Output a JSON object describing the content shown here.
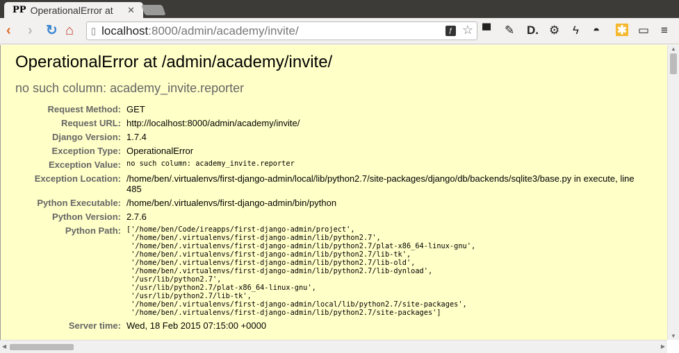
{
  "browser": {
    "tab_title": "OperationalError at",
    "tab_favicon": "PP",
    "url_host": "localhost",
    "url_rest": ":8000/admin/academy/invite/",
    "icons": [
      "back-icon",
      "forward-icon",
      "reload-icon",
      "home-icon",
      "page-icon",
      "flash-icon",
      "star-icon",
      "ninja-extension-icon",
      "pin-extension-icon",
      "d-extension-icon",
      "gear-extension-icon",
      "bolt-extension-icon",
      "mask-extension-icon",
      "asterisk-extension-icon",
      "cast-extension-icon",
      "menu-icon"
    ]
  },
  "page": {
    "title": "OperationalError at /admin/academy/invite/",
    "subtitle": "no such column: academy_invite.reporter",
    "rows": [
      {
        "label": "Request Method:",
        "value": "GET"
      },
      {
        "label": "Request URL:",
        "value": "http://localhost:8000/admin/academy/invite/"
      },
      {
        "label": "Django Version:",
        "value": "1.7.4"
      },
      {
        "label": "Exception Type:",
        "value": "OperationalError"
      },
      {
        "label": "Exception Value:",
        "value": "no such column: academy_invite.reporter"
      },
      {
        "label": "Exception Location:",
        "value": "/home/ben/.virtualenvs/first-django-admin/local/lib/python2.7/site-packages/django/db/backends/sqlite3/base.py in execute, line 485"
      },
      {
        "label": "Python Executable:",
        "value": "/home/ben/.virtualenvs/first-django-admin/bin/python"
      },
      {
        "label": "Python Version:",
        "value": "2.7.6"
      },
      {
        "label": "Python Path:",
        "value": "['/home/ben/Code/ireapps/first-django-admin/project',\n '/home/ben/.virtualenvs/first-django-admin/lib/python2.7',\n '/home/ben/.virtualenvs/first-django-admin/lib/python2.7/plat-x86_64-linux-gnu',\n '/home/ben/.virtualenvs/first-django-admin/lib/python2.7/lib-tk',\n '/home/ben/.virtualenvs/first-django-admin/lib/python2.7/lib-old',\n '/home/ben/.virtualenvs/first-django-admin/lib/python2.7/lib-dynload',\n '/usr/lib/python2.7',\n '/usr/lib/python2.7/plat-x86_64-linux-gnu',\n '/usr/lib/python2.7/lib-tk',\n '/home/ben/.virtualenvs/first-django-admin/local/lib/python2.7/site-packages',\n '/home/ben/.virtualenvs/first-django-admin/lib/python2.7/site-packages']"
      },
      {
        "label": "Server time:",
        "value": "Wed, 18 Feb 2015 07:15:00 +0000"
      }
    ]
  }
}
